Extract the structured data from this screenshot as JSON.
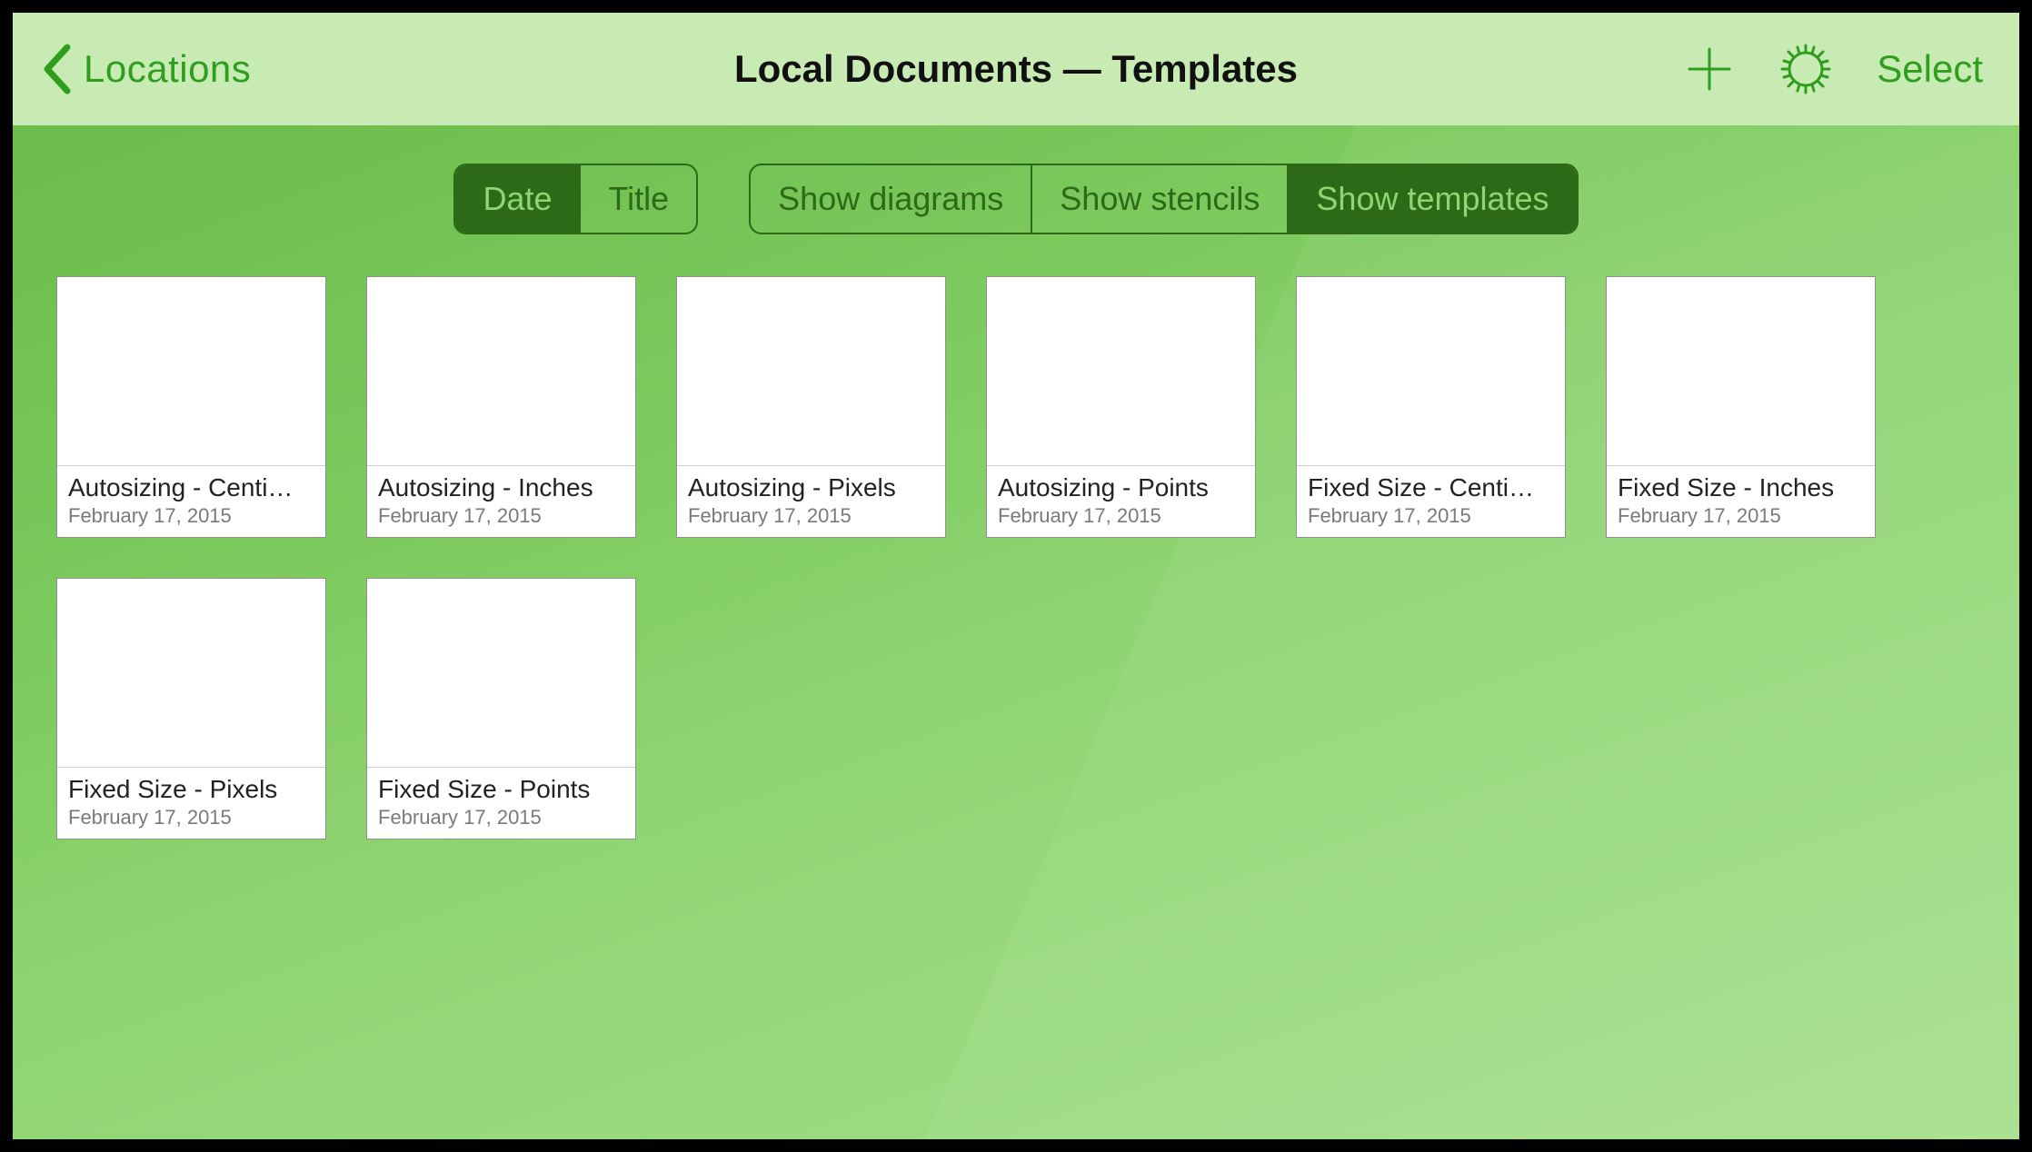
{
  "navbar": {
    "back_label": "Locations",
    "title": "Local Documents — Templates",
    "select_label": "Select"
  },
  "sort": {
    "options": [
      {
        "label": "Date",
        "active": true
      },
      {
        "label": "Title",
        "active": false
      }
    ]
  },
  "filter": {
    "options": [
      {
        "label": "Show diagrams",
        "active": false
      },
      {
        "label": "Show stencils",
        "active": false
      },
      {
        "label": "Show templates",
        "active": true
      }
    ]
  },
  "documents": [
    {
      "title": "Autosizing - Centi…",
      "date": "February 17, 2015"
    },
    {
      "title": "Autosizing - Inches",
      "date": "February 17, 2015"
    },
    {
      "title": "Autosizing - Pixels",
      "date": "February 17, 2015"
    },
    {
      "title": "Autosizing - Points",
      "date": "February 17, 2015"
    },
    {
      "title": "Fixed Size - Centi…",
      "date": "February 17, 2015"
    },
    {
      "title": "Fixed Size - Inches",
      "date": "February 17, 2015"
    },
    {
      "title": "Fixed Size - Pixels",
      "date": "February 17, 2015"
    },
    {
      "title": "Fixed Size - Points",
      "date": "February 17, 2015"
    }
  ]
}
